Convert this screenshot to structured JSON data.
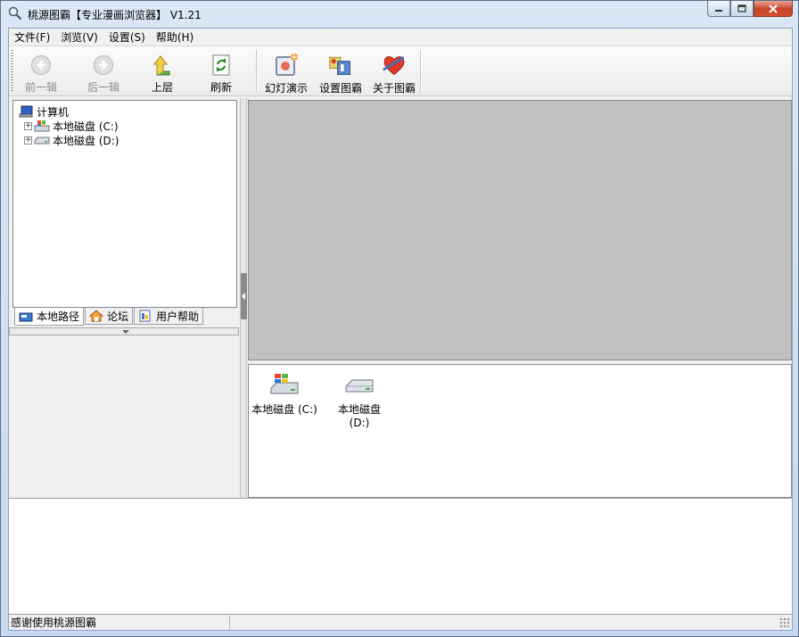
{
  "window": {
    "title": "桃源图霸【专业漫画浏览器】 V1.21"
  },
  "menu": [
    "文件(F)",
    "浏览(V)",
    "设置(S)",
    "帮助(H)"
  ],
  "toolbar": {
    "prev": "前一辑",
    "next": "后一辑",
    "up": "上层",
    "refresh": "刷新",
    "slideshow": "幻灯演示",
    "settings": "设置图霸",
    "about": "关于图霸"
  },
  "tree": {
    "root": "计算机",
    "drive_c": "本地磁盘 (C:)",
    "drive_d": "本地磁盘 (D:)"
  },
  "tabs": [
    "本地路径",
    "论坛",
    "用户帮助"
  ],
  "files": [
    {
      "line1": "本地磁盘 (C:)",
      "line2": ""
    },
    {
      "line1": "本地磁盘",
      "line2": "(D:)"
    }
  ],
  "status": "感谢使用桃源图霸",
  "colors": {
    "preview_bg": "#c0c0c0",
    "title_bar": "#c7d9ee",
    "close_button": "#c7432a"
  }
}
